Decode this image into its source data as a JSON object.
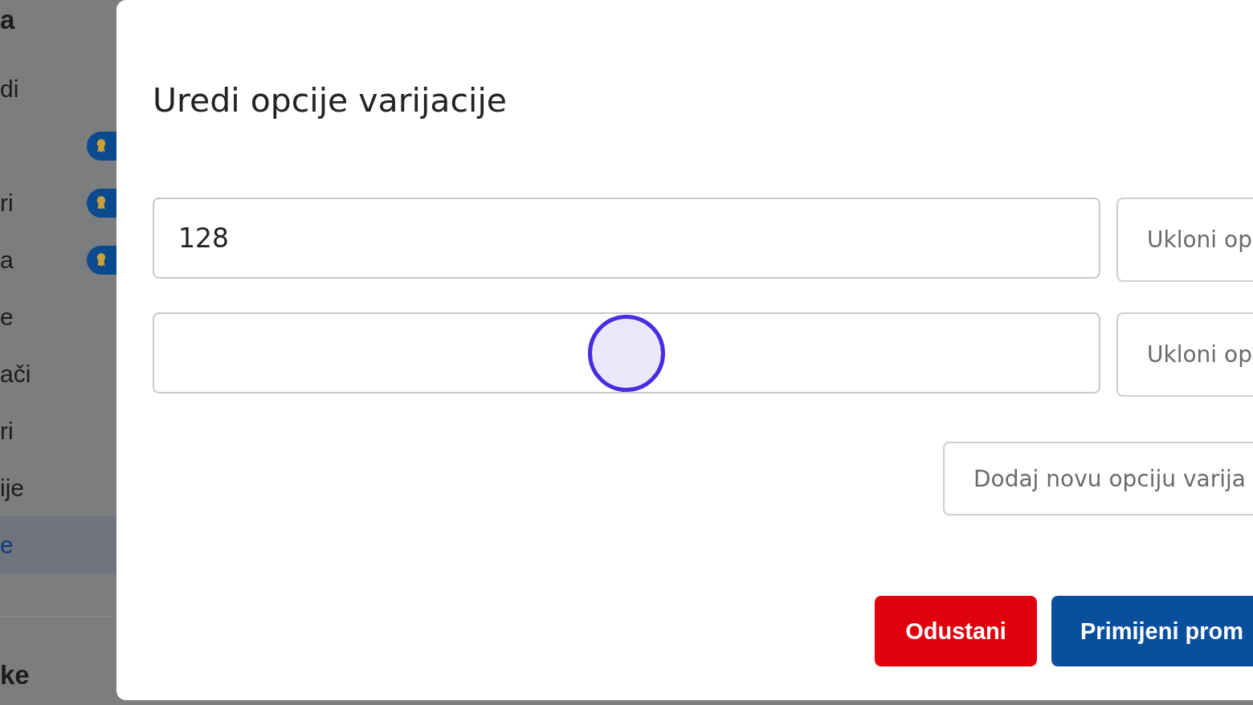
{
  "sidebar": {
    "heading": "a",
    "items": [
      {
        "label": "di",
        "badge": false,
        "selected": false
      },
      {
        "badge": true,
        "selected": false
      },
      {
        "label": "ri",
        "badge": true,
        "selected": false
      },
      {
        "label": "a",
        "badge": true,
        "selected": false
      },
      {
        "label": "e",
        "badge": false,
        "selected": false
      },
      {
        "label": "ači",
        "badge": false,
        "selected": false
      },
      {
        "label": "ri",
        "badge": false,
        "selected": false
      },
      {
        "label": "ije",
        "badge": false,
        "selected": false
      },
      {
        "label": "e",
        "badge": false,
        "selected": true
      }
    ],
    "footer_heading": "ke"
  },
  "dialog": {
    "title": "Uredi opcije varijacije",
    "options": [
      {
        "value": "128",
        "remove_label": "Ukloni op",
        "click_marker": false
      },
      {
        "remove_label": "Ukloni op",
        "click_marker": true
      }
    ],
    "add_button": "Dodaj novu opciju varija",
    "buttons": [
      {
        "label": "Odustani",
        "kind": "danger"
      },
      {
        "label": "Primijeni prom",
        "kind": "primary"
      }
    ]
  }
}
